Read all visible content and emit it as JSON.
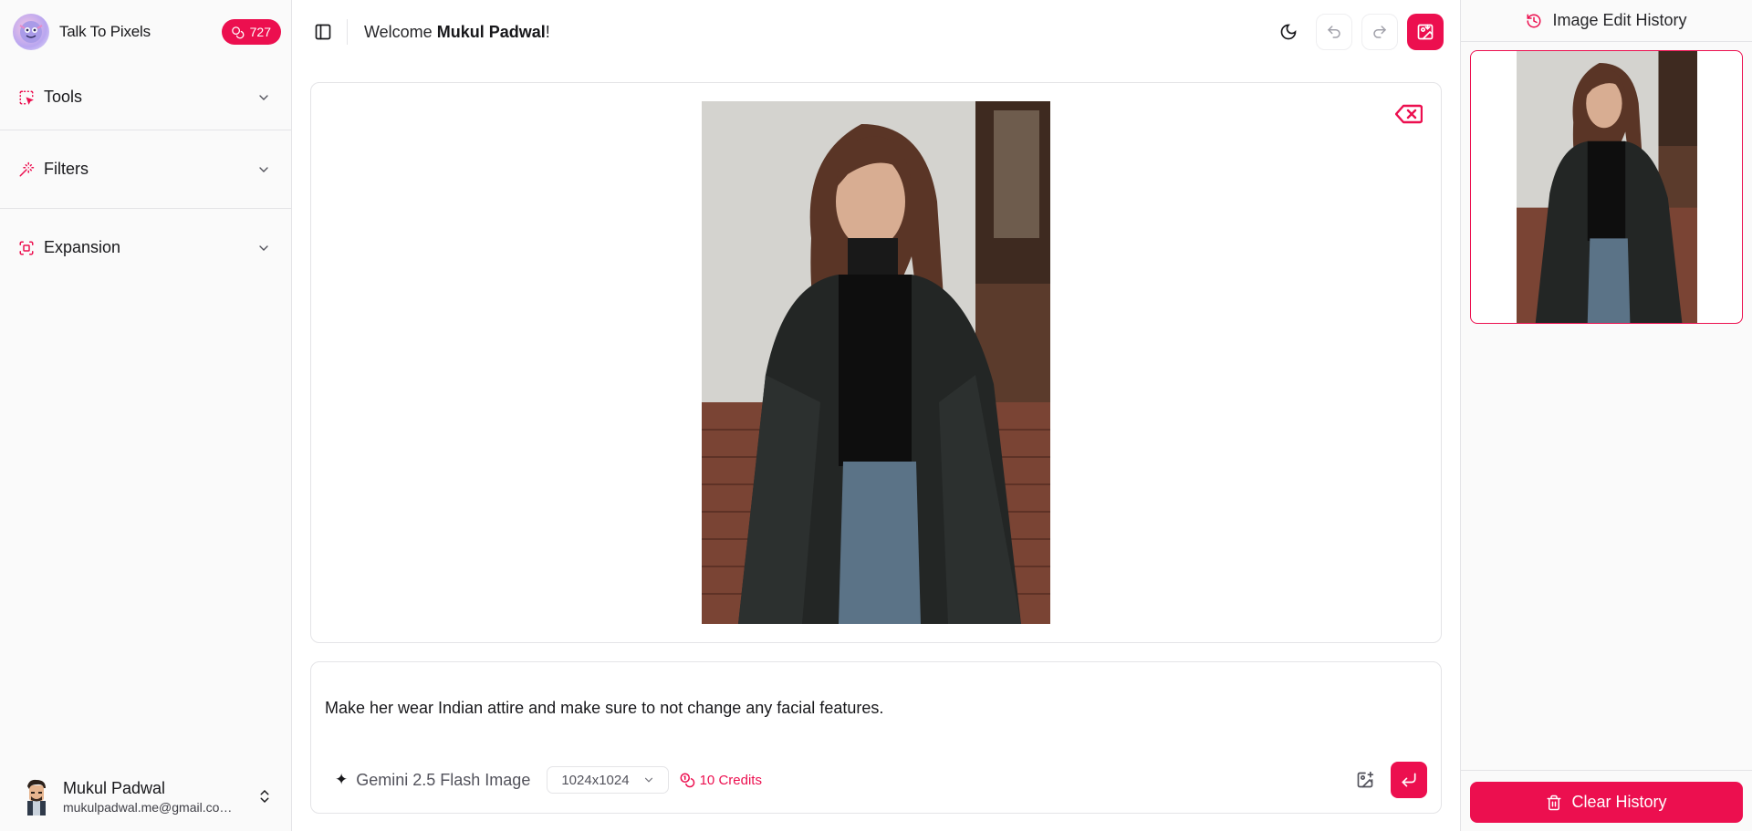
{
  "brand": {
    "name": "Talk To Pixels",
    "credits_badge": "727"
  },
  "sidebar": {
    "sections": [
      {
        "label": "Tools",
        "icon": "select-dashed-icon"
      },
      {
        "label": "Filters",
        "icon": "magic-wand-icon"
      },
      {
        "label": "Expansion",
        "icon": "expand-frame-icon"
      }
    ]
  },
  "user": {
    "name": "Mukul Padwal",
    "email": "mukulpadwal.me@gmail.co…"
  },
  "header": {
    "welcome_prefix": "Welcome ",
    "welcome_name": "Mukul Padwal",
    "welcome_suffix": "!"
  },
  "prompt": {
    "text": "Make her wear Indian attire and make sure to not change any facial features.",
    "model_label": "Gemini 2.5 Flash Image",
    "size_value": "1024x1024",
    "credits_cost": "10 Credits"
  },
  "history": {
    "title": "Image Edit History",
    "clear_label": "Clear History"
  },
  "colors": {
    "accent": "#ec0f4f",
    "border": "#e4e4e7",
    "sidebar_bg": "#fafafa"
  }
}
